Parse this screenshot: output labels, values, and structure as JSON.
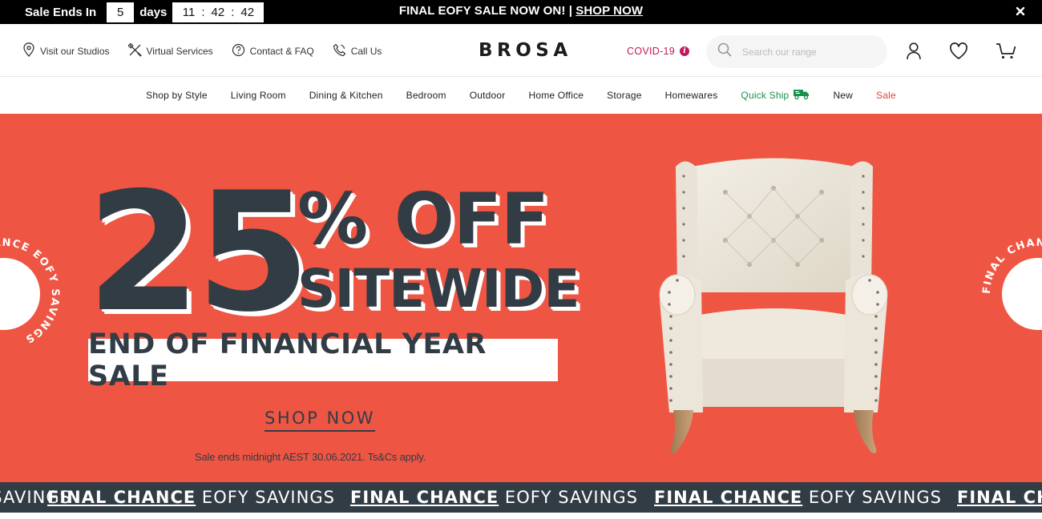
{
  "topbar": {
    "countdown_label": "Sale Ends In",
    "days": "5",
    "days_label": "days",
    "hours": "11",
    "minutes": "42",
    "seconds": "42",
    "separator": ":",
    "promo_text": "FINAL EOFY SALE NOW ON! | ",
    "promo_link": "SHOP NOW",
    "close_icon": "close-icon"
  },
  "header": {
    "util_links": [
      {
        "label": "Visit our Studios",
        "icon": "location-pin-icon"
      },
      {
        "label": "Virtual Services",
        "icon": "tools-icon"
      },
      {
        "label": "Contact & FAQ",
        "icon": "question-circle-icon"
      },
      {
        "label": "Call Us",
        "icon": "phone-icon"
      }
    ],
    "logo": "BROSA",
    "covid_label": "COVID-19",
    "covid_icon_glyph": "i",
    "search_placeholder": "Search our range",
    "icons": [
      "user-icon",
      "heart-icon",
      "cart-icon"
    ]
  },
  "nav": {
    "items": [
      {
        "label": "Shop by Style"
      },
      {
        "label": "Living Room"
      },
      {
        "label": "Dining & Kitchen"
      },
      {
        "label": "Bedroom"
      },
      {
        "label": "Outdoor"
      },
      {
        "label": "Home Office"
      },
      {
        "label": "Storage"
      },
      {
        "label": "Homewares"
      },
      {
        "label": "Quick Ship",
        "icon": "truck-icon"
      },
      {
        "label": "New"
      },
      {
        "label": "Sale"
      }
    ]
  },
  "hero": {
    "big_number": "25",
    "percent": "%",
    "off": "OFF",
    "sitewide": "SITEWIDE",
    "banner": "END OF FINANCIAL YEAR SALE",
    "cta": "SHOP NOW",
    "terms": "Sale ends midnight AEST 30.06.2021. Ts&Cs apply.",
    "seal_text": "FINAL CHANCE EOFY SAVINGS",
    "background_color": "#ef5543",
    "text_color": "#323c45"
  },
  "ticker": {
    "bold": "FINAL CHANCE",
    "regular": " EOFY SAVINGS"
  },
  "colors": {
    "quick_ship": "#1a8f4e",
    "sale": "#e0453a",
    "covid": "#c2185b"
  }
}
